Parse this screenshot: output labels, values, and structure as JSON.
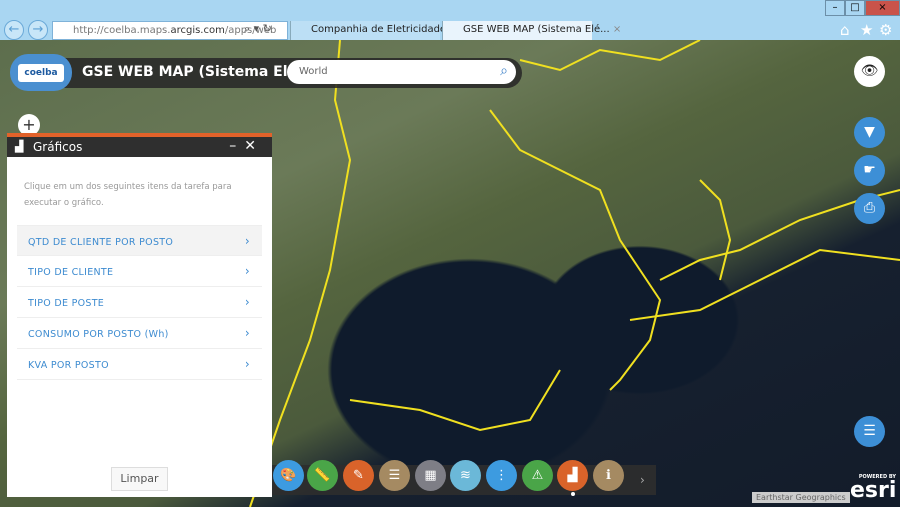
{
  "browser": {
    "url_prefix": "http://coelba.maps.",
    "url_domain": "arcgis.com",
    "url_suffix": "/apps/web",
    "tabs": [
      {
        "title": "Companhia de Eletricidade do..."
      },
      {
        "title": "GSE WEB MAP (Sistema Elé..."
      }
    ]
  },
  "app": {
    "logo_text": "coelba",
    "title": "GSE WEB MAP (Sistema Elétrico)",
    "search_placeholder": "World"
  },
  "panel": {
    "title": "Gráficos",
    "intro": "Clique em um dos seguintes itens da tarefa para executar o gráfico.",
    "items": [
      {
        "label": "QTD DE CLIENTE POR POSTO"
      },
      {
        "label": "TIPO DE CLIENTE"
      },
      {
        "label": "TIPO DE POSTE"
      },
      {
        "label": "CONSUMO POR POSTO (Wh)"
      },
      {
        "label": "KVA POR POSTO"
      }
    ],
    "clear_label": "Limpar"
  },
  "footer": {
    "attribution": "Earthstar Geographics",
    "powered_by": "POWERED BY",
    "esri": "esri"
  },
  "colors": {
    "accent": "#e2622a",
    "button_blue": "#3d8fd6",
    "lines": "#f0e020"
  }
}
